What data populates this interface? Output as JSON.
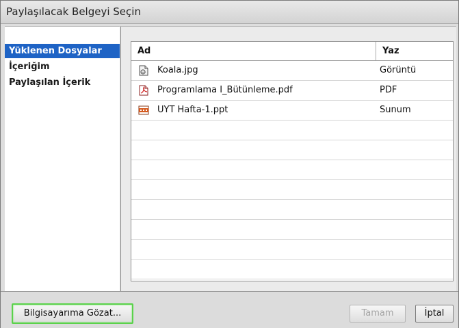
{
  "window": {
    "title": "Paylaşılacak Belgeyi Seçin"
  },
  "sidebar": {
    "items": [
      {
        "label": "Yüklenen Dosyalar",
        "selected": true
      },
      {
        "label": "İçeriğim",
        "selected": false
      },
      {
        "label": "Paylaşılan İçerik",
        "selected": false
      }
    ]
  },
  "table": {
    "columns": [
      "Ad",
      "Yaz"
    ],
    "rows": [
      {
        "name": "Koala.jpg",
        "type": "Görüntü",
        "icon": "image-file-icon"
      },
      {
        "name": "Programlama I_Bütünleme.pdf",
        "type": "PDF",
        "icon": "pdf-file-icon"
      },
      {
        "name": "UYT Hafta-1.ppt",
        "type": "Sunum",
        "icon": "ppt-file-icon"
      }
    ]
  },
  "buttons": {
    "browse": "Bilgisayarıma Gözat...",
    "ok": "Tamam",
    "cancel": "İptal"
  },
  "colors": {
    "selection": "#1e63c5",
    "focus_ring": "#5ad24b"
  }
}
